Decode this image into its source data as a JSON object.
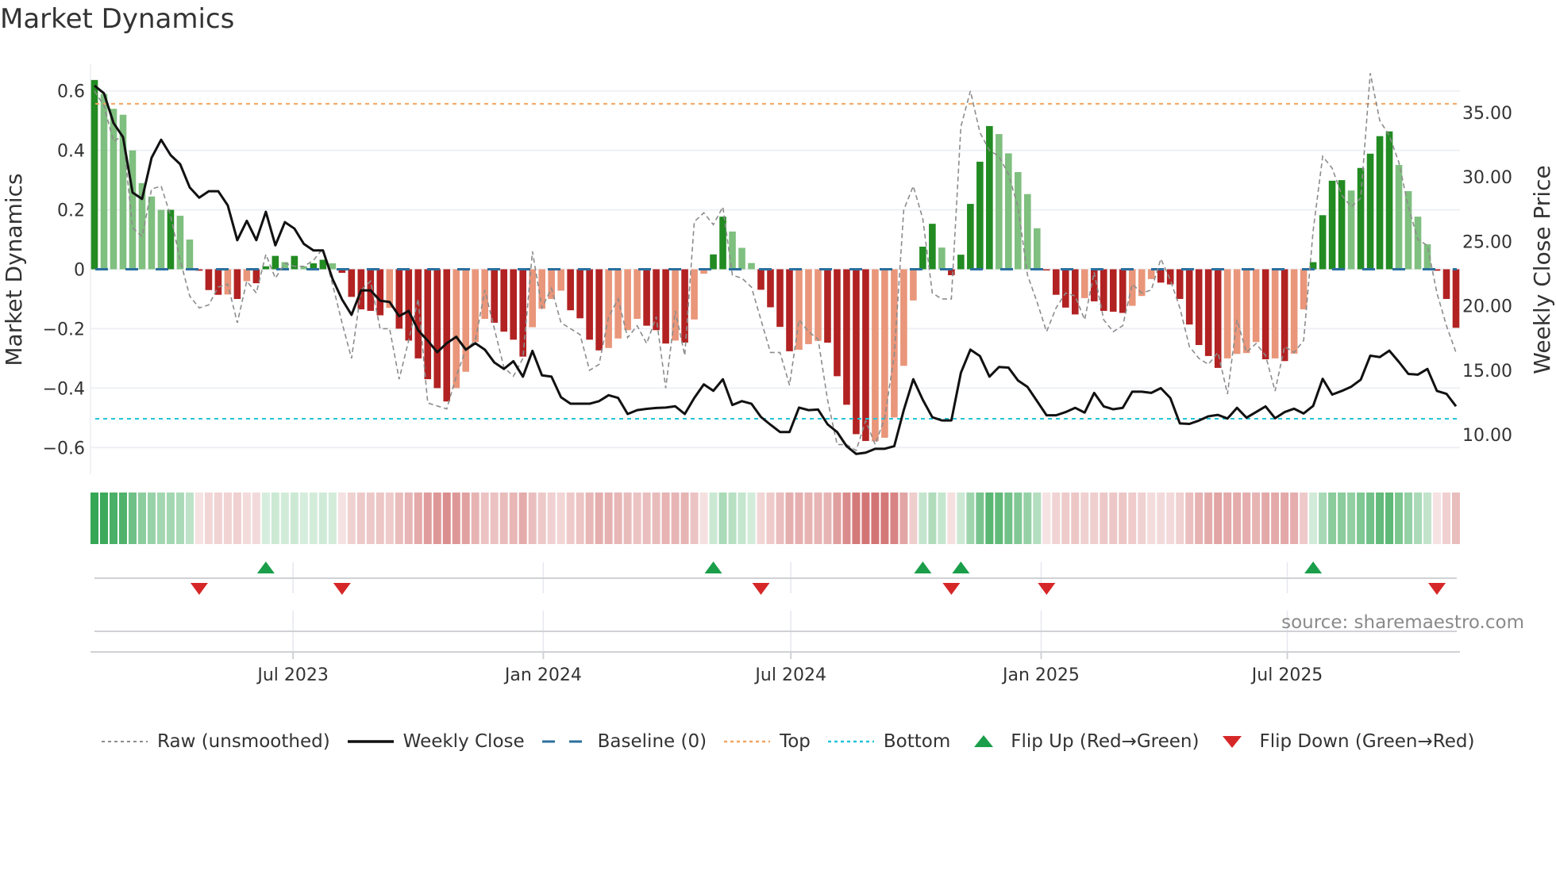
{
  "title": "Market Dynamics",
  "source_note": "source: sharemaestro.com",
  "colors": {
    "pos_strong": "#228b22",
    "pos_fading": "#7fbf7f",
    "neg_strong": "#b22222",
    "neg_fading": "#e9967a",
    "raw": "#8c8c8c",
    "close": "#111111",
    "baseline": "#2b6f9e",
    "top": "#f4a460",
    "bottom": "#22c4d8",
    "flip_up": "#1a9e4a",
    "flip_down": "#d62728"
  },
  "chart_data": {
    "type": "bar",
    "title": "Market Dynamics",
    "ylabel": "Market Dynamics",
    "y2label": "Weekly Close Price",
    "ylim": [
      -0.69,
      0.69
    ],
    "y2lim": [
      6.92,
      38.76
    ],
    "x_start": "2023-02-05",
    "x_step_days": 7,
    "yticks": [
      {
        "v": 0.6,
        "label": "0.6"
      },
      {
        "v": 0.4,
        "label": "0.4"
      },
      {
        "v": 0.2,
        "label": "0.2"
      },
      {
        "v": 0,
        "label": "0"
      },
      {
        "v": -0.2,
        "label": "−0.2"
      },
      {
        "v": -0.4,
        "label": "−0.4"
      },
      {
        "v": -0.6,
        "label": "−0.6"
      }
    ],
    "y2ticks": [
      {
        "v": 35,
        "label": "35.00"
      },
      {
        "v": 30,
        "label": "30.00"
      },
      {
        "v": 25,
        "label": "25.00"
      },
      {
        "v": 20,
        "label": "20.00"
      },
      {
        "v": 15,
        "label": "15.00"
      },
      {
        "v": 10,
        "label": "10.00"
      }
    ],
    "xticks": [
      {
        "date": "2023-07-01",
        "label": "Jul 2023"
      },
      {
        "date": "2024-01-01",
        "label": "Jan 2024"
      },
      {
        "date": "2024-07-01",
        "label": "Jul 2024"
      },
      {
        "date": "2025-01-01",
        "label": "Jan 2025"
      },
      {
        "date": "2025-07-01",
        "label": "Jul 2025"
      }
    ],
    "top_level": 0.557,
    "bottom_level": -0.503,
    "baseline": 0,
    "dynamics": [
      0.637,
      0.59,
      0.54,
      0.52,
      0.4,
      0.29,
      0.245,
      0.2,
      0.2,
      0.18,
      0.1,
      -0.005,
      -0.07,
      -0.086,
      -0.085,
      -0.1,
      -0.04,
      -0.047,
      0.01,
      0.045,
      0.024,
      0.045,
      0.01,
      0.02,
      0.032,
      0.02,
      -0.012,
      -0.093,
      -0.135,
      -0.14,
      -0.155,
      -0.13,
      -0.2,
      -0.24,
      -0.3,
      -0.37,
      -0.4,
      -0.445,
      -0.4,
      -0.345,
      -0.245,
      -0.167,
      -0.18,
      -0.21,
      -0.237,
      -0.294,
      -0.195,
      -0.133,
      -0.1,
      -0.072,
      -0.138,
      -0.165,
      -0.237,
      -0.273,
      -0.265,
      -0.233,
      -0.205,
      -0.167,
      -0.19,
      -0.205,
      -0.25,
      -0.24,
      -0.247,
      -0.169,
      -0.015,
      0.05,
      0.177,
      0.127,
      0.072,
      0.021,
      -0.069,
      -0.128,
      -0.194,
      -0.276,
      -0.271,
      -0.252,
      -0.241,
      -0.247,
      -0.36,
      -0.456,
      -0.555,
      -0.578,
      -0.579,
      -0.567,
      -0.499,
      -0.325,
      -0.105,
      0.076,
      0.153,
      0.073,
      -0.02,
      0.049,
      0.22,
      0.362,
      0.482,
      0.455,
      0.39,
      0.327,
      0.253,
      0.138,
      -0.004,
      -0.086,
      -0.129,
      -0.152,
      -0.097,
      -0.108,
      -0.14,
      -0.143,
      -0.147,
      -0.123,
      -0.09,
      -0.033,
      -0.045,
      -0.051,
      -0.1,
      -0.186,
      -0.255,
      -0.292,
      -0.332,
      -0.3,
      -0.285,
      -0.282,
      -0.245,
      -0.303,
      -0.3,
      -0.309,
      -0.284,
      -0.135,
      0.024,
      0.182,
      0.298,
      0.3,
      0.265,
      0.341,
      0.389,
      0.448,
      0.464,
      0.351,
      0.263,
      0.177,
      0.084,
      -0.005,
      -0.1,
      -0.197
    ],
    "shade": "DLLLLLLLDLLDDDLDLDDDLDLDDLDDDDDLDDDDDDLLLLDDDDLLLLDDDDLLLLDDDLDLLDDLLLDDDDLLLDDDDDLLLLLDDLDDDDDLLLLLDDDDLDDDDLLLDDDDDDDLLLLDLDLLDDDDLDDDDLLLLDDD",
    "raw": [
      0.6,
      0.55,
      0.43,
      0.45,
      0.14,
      0.11,
      0.27,
      0.28,
      0.18,
      0.03,
      -0.09,
      -0.13,
      -0.12,
      -0.06,
      -0.05,
      -0.18,
      -0.04,
      -0.08,
      0.05,
      -0.03,
      0.02,
      0.01,
      0.01,
      0.03,
      0.07,
      -0.05,
      -0.18,
      -0.3,
      -0.07,
      -0.04,
      -0.2,
      -0.2,
      -0.37,
      -0.24,
      -0.1,
      -0.45,
      -0.46,
      -0.47,
      -0.36,
      -0.27,
      -0.24,
      -0.07,
      -0.2,
      -0.33,
      -0.36,
      -0.3,
      0.06,
      -0.13,
      -0.064,
      -0.18,
      -0.2,
      -0.22,
      -0.34,
      -0.32,
      -0.16,
      -0.1,
      -0.23,
      -0.19,
      -0.25,
      -0.16,
      -0.4,
      -0.14,
      -0.29,
      0.16,
      0.19,
      0.15,
      0.21,
      -0.02,
      -0.03,
      -0.06,
      -0.17,
      -0.28,
      -0.28,
      -0.39,
      -0.17,
      -0.21,
      -0.235,
      -0.44,
      -0.59,
      -0.59,
      -0.61,
      -0.51,
      -0.59,
      -0.5,
      -0.29,
      0.2,
      0.28,
      0.17,
      -0.08,
      -0.1,
      -0.1,
      0.48,
      0.6,
      0.46,
      0.4,
      0.38,
      0.32,
      0.21,
      -0.02,
      -0.11,
      -0.21,
      -0.13,
      -0.08,
      -0.09,
      -0.17,
      -0.01,
      -0.17,
      -0.21,
      -0.19,
      -0.05,
      -0.08,
      -0.07,
      0.035,
      -0.036,
      -0.13,
      -0.26,
      -0.3,
      -0.32,
      -0.28,
      -0.42,
      -0.17,
      -0.28,
      -0.25,
      -0.29,
      -0.41,
      -0.26,
      -0.28,
      -0.24,
      0.13,
      0.38,
      0.34,
      0.25,
      0.21,
      0.24,
      0.66,
      0.5,
      0.45,
      0.36,
      0.21,
      0.1,
      0.08,
      -0.08,
      -0.19,
      -0.28
    ],
    "weekly_close": [
      37.1,
      36.5,
      34.2,
      33.1,
      28.8,
      28.3,
      31.5,
      32.9,
      31.7,
      31.0,
      29.2,
      28.4,
      28.9,
      28.9,
      27.8,
      25.1,
      26.6,
      25.1,
      27.3,
      24.7,
      26.5,
      26.0,
      24.8,
      24.3,
      24.3,
      22.1,
      20.5,
      19.3,
      21.2,
      21.2,
      20.4,
      20.3,
      19.2,
      19.6,
      18.1,
      17.3,
      16.4,
      17.1,
      17.6,
      16.6,
      17.1,
      16.6,
      15.6,
      15.1,
      15.7,
      14.5,
      16.5,
      14.6,
      14.5,
      12.9,
      12.4,
      12.4,
      12.4,
      12.6,
      13.06,
      12.85,
      11.6,
      11.9,
      12.0,
      12.07,
      12.1,
      12.2,
      11.6,
      12.85,
      13.9,
      13.4,
      14.3,
      12.3,
      12.6,
      12.4,
      11.37,
      10.77,
      10.2,
      10.2,
      12.1,
      11.9,
      11.95,
      10.8,
      10.2,
      9.1,
      8.5,
      8.6,
      8.9,
      8.9,
      9.1,
      11.9,
      14.3,
      12.7,
      11.35,
      11.1,
      11.1,
      14.8,
      16.6,
      16.1,
      14.5,
      15.25,
      15.2,
      14.2,
      13.7,
      12.6,
      11.5,
      11.5,
      11.75,
      12.08,
      11.71,
      13.24,
      12.19,
      11.97,
      12.08,
      13.33,
      13.33,
      13.24,
      13.61,
      12.84,
      10.87,
      10.83,
      11.09,
      11.42,
      11.53,
      11.25,
      12.08,
      11.31,
      11.75,
      12.19,
      11.27,
      11.75,
      12.01,
      11.64,
      12.23,
      14.33,
      13.11,
      13.39,
      13.72,
      14.27,
      16.13,
      16.02,
      16.52,
      15.65,
      14.71,
      14.66,
      15.1,
      13.39,
      13.17,
      12.2
    ],
    "flip_up_weeks": [
      18,
      65,
      87,
      91,
      128
    ],
    "flip_down_weeks": [
      11,
      26,
      70,
      90,
      100,
      141
    ],
    "legend": {
      "placement": "bottom",
      "items": [
        {
          "key": "raw",
          "label": "Raw (unsmoothed)"
        },
        {
          "key": "close",
          "label": "Weekly Close"
        },
        {
          "key": "baseline",
          "label": "Baseline (0)"
        },
        {
          "key": "top",
          "label": "Top"
        },
        {
          "key": "bottom",
          "label": "Bottom"
        },
        {
          "key": "flip_up",
          "label": "Flip Up (Red→Green)"
        },
        {
          "key": "flip_down",
          "label": "Flip Down (Green→Red)"
        }
      ]
    }
  }
}
